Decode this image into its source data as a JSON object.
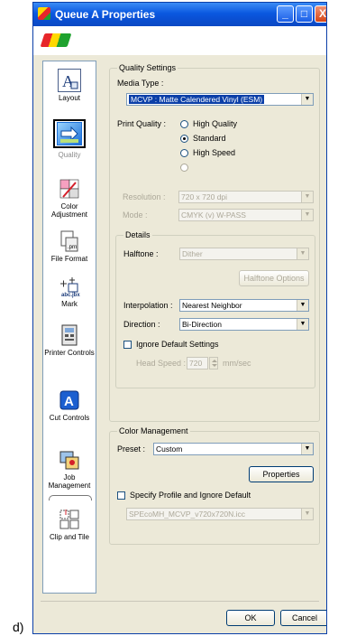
{
  "caption": "d)",
  "window": {
    "title": "Queue A Properties",
    "buttons": {
      "minimize": "_",
      "maximize": "□",
      "close": "X"
    }
  },
  "sidebar": {
    "items": [
      {
        "label": "Layout",
        "icon": "layout-icon"
      },
      {
        "label": "Quality",
        "icon": "quality-icon",
        "selected": true
      },
      {
        "label": "Color Adjustment",
        "icon": "color-adjustment-icon"
      },
      {
        "label": "File Format",
        "icon": "file-format-icon"
      },
      {
        "label": "Mark",
        "icon": "mark-icon"
      },
      {
        "label": "Printer Controls",
        "icon": "printer-controls-icon"
      },
      {
        "label": "Cut Controls",
        "icon": "cut-controls-icon"
      },
      {
        "label": "Job Management",
        "icon": "job-management-icon"
      },
      {
        "label": "Clip and Tile",
        "icon": "clip-and-tile-icon"
      }
    ]
  },
  "quality_settings": {
    "title": "Quality Settings",
    "media_type_label": "Media Type :",
    "media_type_value": "MCVP : Matte Calendered Vinyl (ESM)",
    "print_quality_label": "Print Quality :",
    "print_quality_options": [
      "High Quality",
      "Standard",
      "High Speed",
      ""
    ],
    "print_quality_selected": "Standard",
    "resolution_label": "Resolution :",
    "resolution_value": "720 x 720 dpi",
    "mode_label": "Mode :",
    "mode_value": "CMYK (v) W-PASS"
  },
  "details": {
    "title": "Details",
    "halftone_label": "Halftone :",
    "halftone_value": "Dither",
    "halftone_options_button": "Halftone Options",
    "interpolation_label": "Interpolation :",
    "interpolation_value": "Nearest Neighbor",
    "direction_label": "Direction :",
    "direction_value": "Bi-Direction",
    "ignore_defaults_label": "Ignore Default Settings",
    "head_speed_label": "Head Speed :",
    "head_speed_value": "720",
    "head_speed_unit": "mm/sec"
  },
  "color_management": {
    "title": "Color Management",
    "preset_label": "Preset :",
    "preset_value": "Custom",
    "properties_button": "Properties",
    "specify_profile_label": "Specify Profile and Ignore Default",
    "profile_value": "SPEcoMH_MCVP_v720x720N.icc"
  },
  "footer": {
    "ok_label": "OK",
    "cancel_label": "Cancel"
  }
}
